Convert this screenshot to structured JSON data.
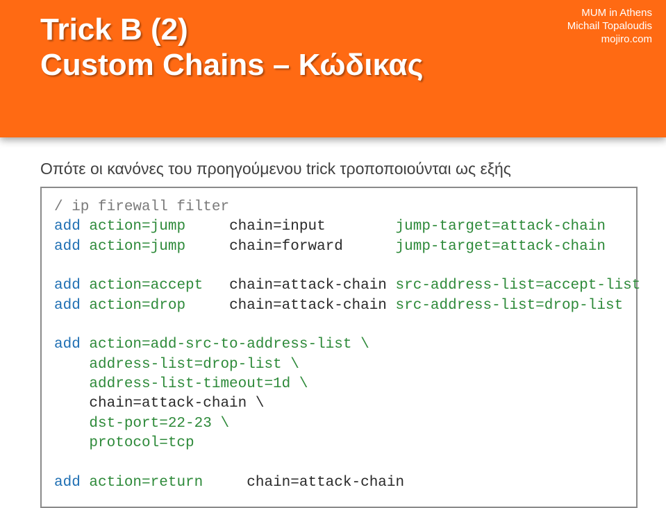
{
  "meta": {
    "line1": "MUM in Athens",
    "line2": "Michail Topaloudis",
    "line3": "mojiro.com"
  },
  "title": {
    "line1": "Trick B (2)",
    "line2": "Custom Chains – Κώδικας"
  },
  "intro": "Οπότε οι κανόνες του προηγούμενου trick τροποποιούνται ως εξής",
  "code": {
    "p0": "/ ip firewall filter",
    "p1a": "add ",
    "p1b": "action=jump     ",
    "p1c": "chain=input        ",
    "p1d": "jump-target=attack-chain",
    "p2a": "add ",
    "p2b": "action=jump     ",
    "p2c": "chain=forward      ",
    "p2d": "jump-target=attack-chain",
    "p3a": "add ",
    "p3b": "action=accept   ",
    "p3c": "chain=attack-chain ",
    "p3d": "src-address-list=accept-list",
    "p4a": "add ",
    "p4b": "action=drop     ",
    "p4c": "chain=attack-chain ",
    "p4d": "src-address-list=drop-list",
    "p5a": "add ",
    "p5b": "action=add-src-to-address-list \\",
    "p6": "    address-list=drop-list \\",
    "p7": "    address-list-timeout=1d \\",
    "p8": "    chain=attack-chain \\",
    "p9": "    dst-port=22-23 \\",
    "p10": "    protocol=tcp",
    "p11a": "add ",
    "p11b": "action=return     ",
    "p11c": "chain=attack-chain"
  }
}
